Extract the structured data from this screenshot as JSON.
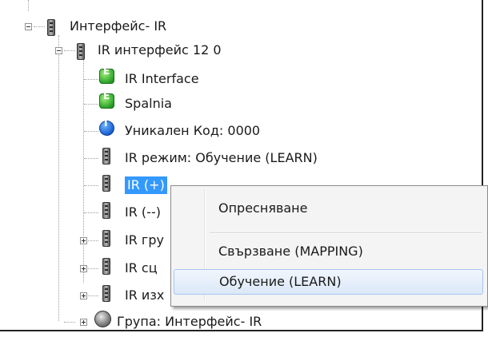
{
  "tree": {
    "root": {
      "label": "Интерфейс- IR"
    },
    "interface": {
      "label": "IR интерфейс 12 0"
    },
    "children": [
      {
        "label": "IR Interface"
      },
      {
        "label": "Spalnia"
      },
      {
        "label": "Уникален Код: 0000"
      },
      {
        "label": "IR режим: Обучение (LEARN)"
      },
      {
        "label": "IR (+)"
      },
      {
        "label": "IR (--)"
      },
      {
        "label": "IR гру"
      },
      {
        "label": "IR сц"
      },
      {
        "label": "IR изх"
      }
    ],
    "group": {
      "label": "Група: Интерфейс- IR"
    }
  },
  "context_menu": {
    "items": [
      {
        "label": "Опресняване"
      },
      {
        "label": "Свързване (MAPPING)"
      },
      {
        "label": "Обучение (LEARN)"
      }
    ]
  }
}
